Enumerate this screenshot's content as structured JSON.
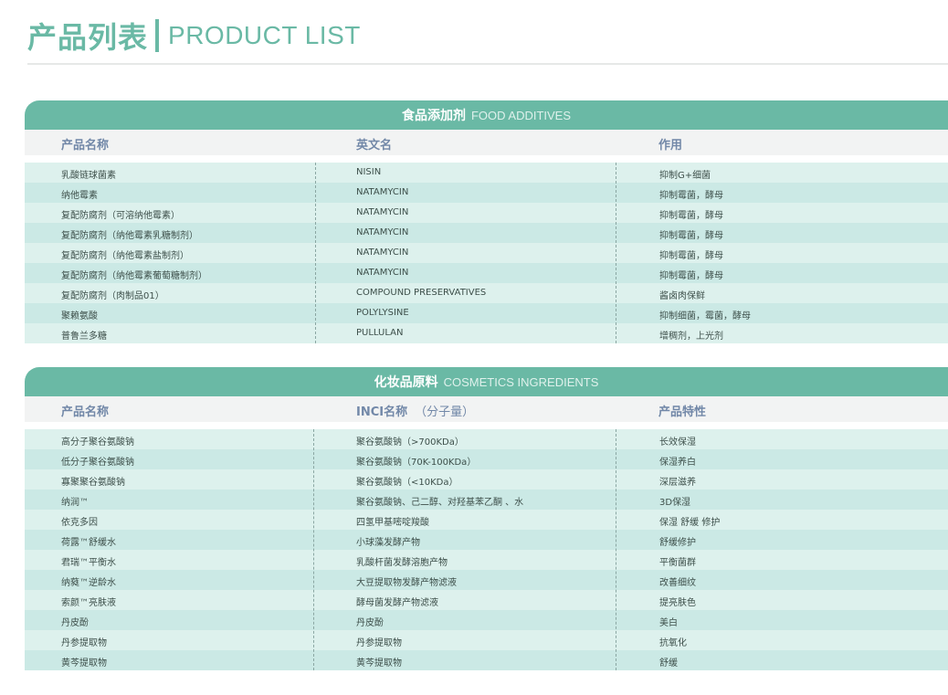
{
  "page": {
    "title_cn": "产品列表",
    "title_en": "PRODUCT LIST"
  },
  "sections": [
    {
      "title_cn": "食品添加剂",
      "title_en": "FOOD ADDITIVES",
      "columns": [
        "产品名称",
        "英文名",
        "作用"
      ],
      "rows": [
        [
          "乳酸链球菌素",
          "NISIN",
          "抑制G+细菌"
        ],
        [
          "纳他霉素",
          "NATAMYCIN",
          "抑制霉菌，酵母"
        ],
        [
          "复配防腐剂（可溶纳他霉素）",
          "NATAMYCIN",
          "抑制霉菌，酵母"
        ],
        [
          "复配防腐剂（纳他霉素乳糖制剂）",
          "NATAMYCIN",
          "抑制霉菌，酵母"
        ],
        [
          "复配防腐剂（纳他霉素盐制剂）",
          "NATAMYCIN",
          "抑制霉菌，酵母"
        ],
        [
          "复配防腐剂（纳他霉素葡萄糖制剂）",
          "NATAMYCIN",
          "抑制霉菌，酵母"
        ],
        [
          "复配防腐剂（肉制品01）",
          "COMPOUND PRESERVATIVES",
          "酱卤肉保鲜"
        ],
        [
          "聚赖氨酸",
          "POLYLYSINE",
          "抑制细菌，霉菌，酵母"
        ],
        [
          "普鲁兰多糖",
          "PULLULAN",
          "增稠剂，上光剂"
        ]
      ]
    },
    {
      "title_cn": "化妆品原料",
      "title_en": "COSMETICS INGREDIENTS",
      "columns": [
        "产品名称",
        "INCI名称",
        "产品特性"
      ],
      "column2_sub": "（分子量）",
      "rows": [
        [
          "高分子聚谷氨酸钠",
          "聚谷氨酸钠（>700KDa）",
          "长效保湿"
        ],
        [
          "低分子聚谷氨酸钠",
          "聚谷氨酸钠（70K-100KDa）",
          "保湿养白"
        ],
        [
          "寡聚聚谷氨酸钠",
          "聚谷氨酸钠（<10KDa）",
          "深层滋养"
        ],
        [
          "纳润™",
          "聚谷氨酸钠、己二醇、对羟基苯乙酮 、水",
          "3D保湿"
        ],
        [
          "依克多因",
          "四氢甲基嘧啶羧酸",
          "保湿 舒缓 修护"
        ],
        [
          "荷露™舒缓水",
          "小球藻发酵产物",
          "舒缓修护"
        ],
        [
          "君瑞™平衡水",
          "乳酸杆菌发酵溶胞产物",
          "平衡菌群"
        ],
        [
          "纳蕤™逆龄水",
          "大豆提取物发酵产物滤液",
          "改善细纹"
        ],
        [
          "索颜™亮肤液",
          "酵母菌发酵产物滤液",
          "提亮肤色"
        ],
        [
          "丹皮酚",
          "丹皮酚",
          "美白"
        ],
        [
          "丹参提取物",
          "丹参提取物",
          "抗氧化"
        ],
        [
          "黄芩提取物",
          "黄芩提取物",
          "舒缓"
        ]
      ]
    }
  ],
  "colors": {
    "accent": "#6ab9a5",
    "row_light": "#ddf1ed",
    "row_dark": "#cbe9e5",
    "side_bar": "#f6d8c9",
    "header_text": "#7288a8"
  }
}
